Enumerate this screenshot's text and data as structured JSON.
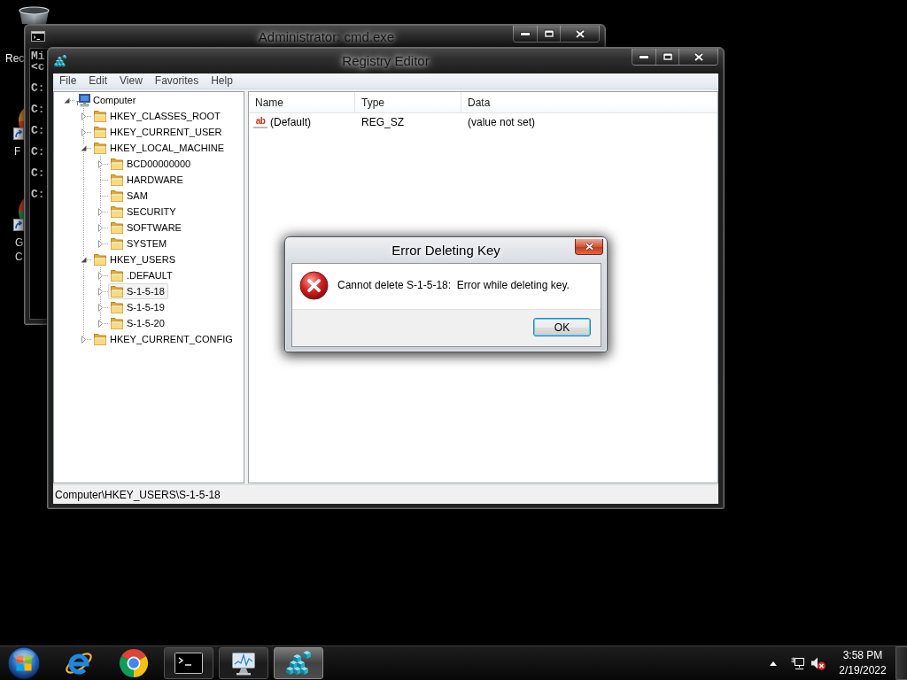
{
  "desktop": {
    "icons": [
      {
        "label": "Rec"
      },
      {
        "label": "F"
      },
      {
        "label": "G C"
      }
    ]
  },
  "cmd_window": {
    "title": "Administrator: cmd.exe",
    "lines": [
      {
        "kind": "banner",
        "text": "Mi"
      },
      {
        "kind": "banner",
        "text": "<c"
      },
      {
        "kind": "prompt",
        "text": "C:"
      },
      {
        "kind": "prompt",
        "text": "C:"
      },
      {
        "kind": "prompt",
        "text": "C:"
      },
      {
        "kind": "prompt",
        "text": "C:"
      },
      {
        "kind": "prompt",
        "text": "C:"
      },
      {
        "kind": "prompt",
        "text": "C:"
      }
    ]
  },
  "registry_window": {
    "title": "Registry Editor",
    "menu": [
      "File",
      "Edit",
      "View",
      "Favorites",
      "Help"
    ],
    "tree": [
      {
        "label": "Computer",
        "kind": "computer",
        "expanded": true,
        "selected": false,
        "children": [
          {
            "label": "HKEY_CLASSES_ROOT",
            "kind": "folder",
            "expanded": false,
            "selected": false
          },
          {
            "label": "HKEY_CURRENT_USER",
            "kind": "folder",
            "expanded": false,
            "selected": false
          },
          {
            "label": "HKEY_LOCAL_MACHINE",
            "kind": "folder",
            "expanded": true,
            "selected": false,
            "children": [
              {
                "label": "BCD00000000",
                "kind": "folder",
                "expanded": false,
                "selected": false
              },
              {
                "label": "HARDWARE",
                "kind": "folder",
                "selected": false
              },
              {
                "label": "SAM",
                "kind": "folder",
                "selected": false
              },
              {
                "label": "SECURITY",
                "kind": "folder",
                "expanded": false,
                "selected": false
              },
              {
                "label": "SOFTWARE",
                "kind": "folder",
                "expanded": false,
                "selected": false
              },
              {
                "label": "SYSTEM",
                "kind": "folder",
                "expanded": false,
                "selected": false
              }
            ]
          },
          {
            "label": "HKEY_USERS",
            "kind": "folder",
            "expanded": true,
            "selected": false,
            "children": [
              {
                "label": ".DEFAULT",
                "kind": "folder",
                "expanded": false,
                "selected": false
              },
              {
                "label": "S-1-5-18",
                "kind": "folder",
                "expanded": false,
                "selected": true
              },
              {
                "label": "S-1-5-19",
                "kind": "folder",
                "expanded": false,
                "selected": false
              },
              {
                "label": "S-1-5-20",
                "kind": "folder",
                "expanded": false,
                "selected": false
              }
            ]
          },
          {
            "label": "HKEY_CURRENT_CONFIG",
            "kind": "folder",
            "expanded": false,
            "selected": false
          }
        ]
      }
    ],
    "columns": [
      "Name",
      "Type",
      "Data"
    ],
    "rows": [
      {
        "icon_text": "ab",
        "name": "(Default)",
        "type": "REG_SZ",
        "data": "(value not set)",
        "selected": false
      }
    ],
    "status_bar": "Computer\\HKEY_USERS\\S-1-5-18"
  },
  "dialog": {
    "title": "Error Deleting Key",
    "message": "Cannot delete S-1-5-18:  Error while deleting key.",
    "buttons": [
      {
        "label": "OK",
        "focused": true
      }
    ]
  },
  "taskbar": {
    "buttons": [
      {
        "running": false,
        "selected": false
      },
      {
        "running": false,
        "selected": false
      },
      {
        "running": true,
        "selected": false
      },
      {
        "running": true,
        "selected": false
      },
      {
        "running": true,
        "selected": true
      }
    ],
    "clock": {
      "time": "3:58 PM",
      "date": "2/19/2022"
    }
  }
}
